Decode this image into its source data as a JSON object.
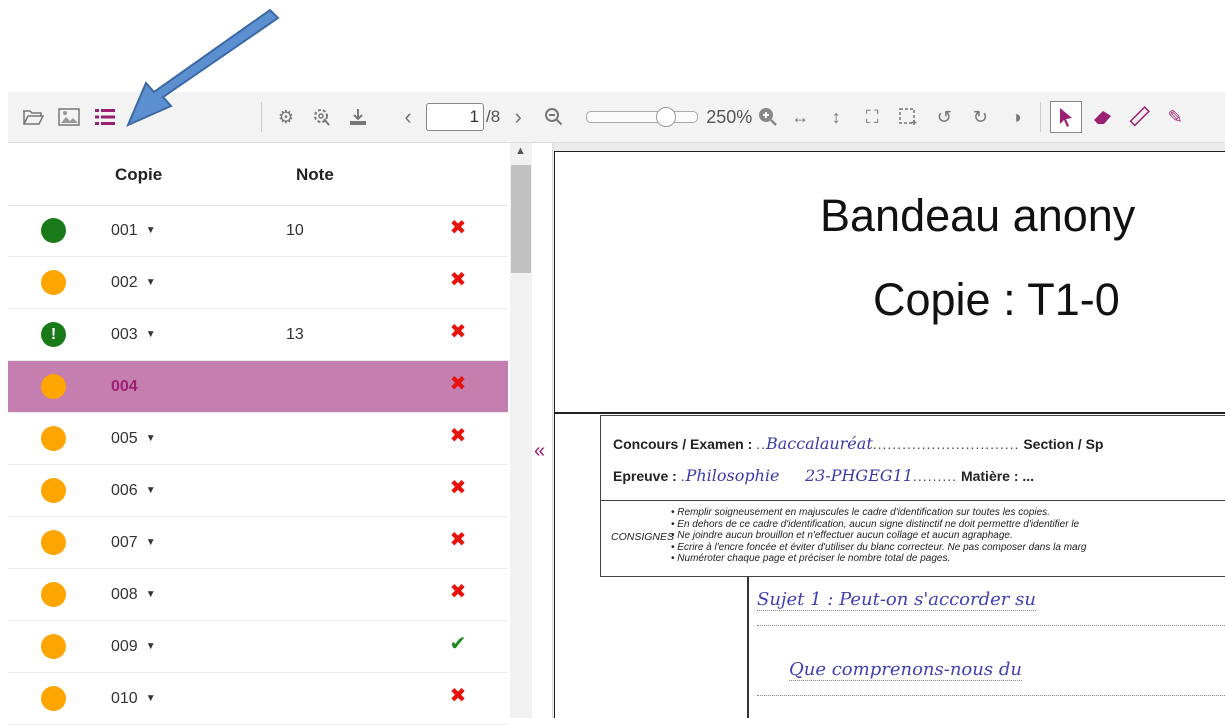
{
  "toolbar": {
    "page_current": "1",
    "page_total": "/8",
    "zoom_percent": "250%",
    "zoom_level": 0.75
  },
  "table": {
    "header_copie": "Copie",
    "header_note": "Note",
    "rows": [
      {
        "status_color": "#1a7a1a",
        "alert": false,
        "copie": "001",
        "note": "10",
        "state": "cross",
        "selected": false
      },
      {
        "status_color": "#ffa500",
        "alert": false,
        "copie": "002",
        "note": "",
        "state": "cross",
        "selected": false
      },
      {
        "status_color": "#1a7a1a",
        "alert": true,
        "copie": "003",
        "note": "13",
        "state": "cross",
        "selected": false
      },
      {
        "status_color": "#ffa500",
        "alert": false,
        "copie": "004",
        "note": "",
        "state": "cross",
        "selected": true
      },
      {
        "status_color": "#ffa500",
        "alert": false,
        "copie": "005",
        "note": "",
        "state": "cross",
        "selected": false
      },
      {
        "status_color": "#ffa500",
        "alert": false,
        "copie": "006",
        "note": "",
        "state": "cross",
        "selected": false
      },
      {
        "status_color": "#ffa500",
        "alert": false,
        "copie": "007",
        "note": "",
        "state": "cross",
        "selected": false
      },
      {
        "status_color": "#ffa500",
        "alert": false,
        "copie": "008",
        "note": "",
        "state": "cross",
        "selected": false
      },
      {
        "status_color": "#ffa500",
        "alert": false,
        "copie": "009",
        "note": "",
        "state": "check",
        "selected": false
      },
      {
        "status_color": "#ffa500",
        "alert": false,
        "copie": "010",
        "note": "",
        "state": "cross",
        "selected": false
      }
    ]
  },
  "document": {
    "bandeau_title": "Bandeau anony",
    "bandeau_copie": "Copie : T1-0",
    "concours_label": "Concours / Examen :",
    "concours_value": "Baccalauréat",
    "section_label": "Section / Sp",
    "epreuve_label": "Epreuve :",
    "epreuve_value": "Philosophie     23-PHGEG11",
    "matiere_label": "Matière : ...",
    "consignes_label": "CONSIGNES",
    "consignes": [
      "• Remplir soigneusement en majuscules le cadre d'identification sur toutes les copies.",
      "• En dehors de ce cadre d'identification, aucun signe distinctif ne doit permettre d'identifier le",
      "• Ne joindre aucun brouillon et n'effectuer aucun collage et aucun agraphage.",
      "• Ecrire à l'encre foncée et éviter d'utiliser du blanc correcteur. Ne pas composer dans la marg",
      "• Numéroter chaque page et préciser le nombre total de pages."
    ],
    "handwriting_lines": [
      "Sujet 1 : Peut-on s'accorder su",
      "Que comprenons-nous du"
    ]
  },
  "colors": {
    "accent": "#9b1f72",
    "selected_row": "#c57eb0",
    "cross": "#e8120c",
    "check": "#1e8a1e",
    "arrow": "#5b8fd0"
  },
  "icons": {
    "cross": "✖",
    "check": "✔",
    "alert": "!",
    "caret": "▼",
    "collapse": "«",
    "scroll_up": "▲"
  }
}
